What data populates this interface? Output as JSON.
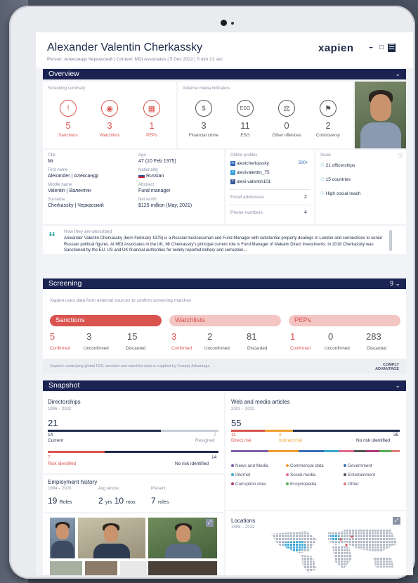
{
  "header": {
    "name": "Alexander Valentin Cherkassky",
    "subtitle": "Person: Александр Черкасский | Context: MDI Associates | 5 Dec 2022 | 5 min 21 sec",
    "logo": "xapien"
  },
  "overview": {
    "title": "Overview",
    "screening_summary": "Screening summary",
    "adverse_title": "Adverse media indicators",
    "screening": [
      {
        "value": "5",
        "label": "Sanctions"
      },
      {
        "value": "3",
        "label": "Watchlists"
      },
      {
        "value": "1",
        "label": "PEPs"
      }
    ],
    "adverse": [
      {
        "value": "3",
        "label": "Financial crime"
      },
      {
        "value": "11",
        "label": "ESG"
      },
      {
        "value": "0",
        "label": "Other offences"
      },
      {
        "value": "2",
        "label": "Controversy"
      }
    ],
    "details": {
      "title_label": "Title",
      "title_value": "Mr",
      "first_label": "First name",
      "first_value": "Alexander | Александр",
      "middle_label": "Middle name",
      "middle_value": "Valentin | Валентин",
      "surname_label": "Surname",
      "surname_value": "Cherkassky | Черкасский",
      "age_label": "Age",
      "age_value": "47 (10 Feb 1975)",
      "nationality_label": "Nationality",
      "nationality_value": "Russian",
      "abstract_label": "Abstract",
      "abstract_value": "Fund manager",
      "networth_label": "Net worth",
      "networth_value": "$125 million (May, 2021)"
    },
    "online": {
      "label": "Online profiles",
      "profiles": [
        "alexicherkassky",
        "alexivalentin_75",
        "alexi.valentin101"
      ],
      "count": "500+",
      "email_label": "Email addresses",
      "email_count": "2",
      "phone_label": "Phone numbers",
      "phone_count": "4"
    },
    "scale": {
      "label": "Scale",
      "items": [
        "21 officerships",
        "15 countries",
        "High social reach"
      ]
    },
    "described_label": "How they are described",
    "described_text": "Alexander Valentin Cherkassky (born February 1975) is a Russian businessman and Fund Manager with substantial property dealings in London and connections to senior Russian political figures. At MDI Associates in the UK, Mr Cherkassky's principal current role is Fund Manager of Makaim Direct Investments. In 2018 Cherkassky was Sanctioned by the EU, US and UK financial authorities for widely reported bribery and corruption..."
  },
  "screening": {
    "title": "Screening",
    "count": "9",
    "desc": "Xapien uses data from external sources to confirm screening matches",
    "groups": [
      {
        "name": "Sanctions",
        "confirmed": "5",
        "unconfirmed": "3",
        "discarded": "15"
      },
      {
        "name": "Watchlists",
        "confirmed": "3",
        "unconfirmed": "2",
        "discarded": "81"
      },
      {
        "name": "PEPs",
        "confirmed": "1",
        "unconfirmed": "0",
        "discarded": "283"
      }
    ],
    "labels": {
      "confirmed": "Confirmed",
      "unconfirmed": "Unconfirmed",
      "discarded": "Discarded"
    },
    "footer": "Xapien's underlying global PEP, sanction and watchlist data is supplied by Comply Advantage",
    "provider": "COMPLY ADVANTAGE"
  },
  "snapshot": {
    "title": "Snapshot",
    "directorships": {
      "title": "Directorships",
      "range": "1996 – 2022",
      "total": "21",
      "current": "14",
      "current_label": "Current",
      "resigned": "7",
      "resigned_label": "Resigned",
      "risk": "7",
      "risk_label": "Risk identified",
      "norisk": "14",
      "norisk_label": "No risk identified"
    },
    "web": {
      "title": "Web and media articles",
      "range": "2001 – 2022",
      "total": "55",
      "direct": "11",
      "direct_label": "Direct risk",
      "indirect": "9",
      "indirect_label": "Indirect risk",
      "norisk": "35",
      "norisk_label": "No risk identified",
      "legend": [
        {
          "label": "News and Media",
          "color": "#7b5ea7"
        },
        {
          "label": "Commercial data",
          "color": "#f0a030"
        },
        {
          "label": "Government",
          "color": "#3b6fb6"
        },
        {
          "label": "Internet",
          "color": "#3aa8c8"
        },
        {
          "label": "Social media",
          "color": "#e26a8a"
        },
        {
          "label": "Entertainment",
          "color": "#555555"
        },
        {
          "label": "Corruption sites",
          "color": "#b03a7a"
        },
        {
          "label": "Encyclopedia",
          "color": "#5aaa5a"
        },
        {
          "label": "Other",
          "color": "#e07a7a"
        }
      ]
    },
    "employment": {
      "title": "Employment history",
      "range": "1994 – 2020",
      "avg_label": "Avg tenure",
      "present_label": "Present",
      "roles": "19",
      "roles_unit": "Roles",
      "years": "2",
      "years_unit": "yrs",
      "months": "10",
      "months_unit": "mos",
      "present": "7",
      "present_unit": "roles"
    },
    "locations": {
      "title": "Locations",
      "range": "1998 – 2022"
    }
  }
}
